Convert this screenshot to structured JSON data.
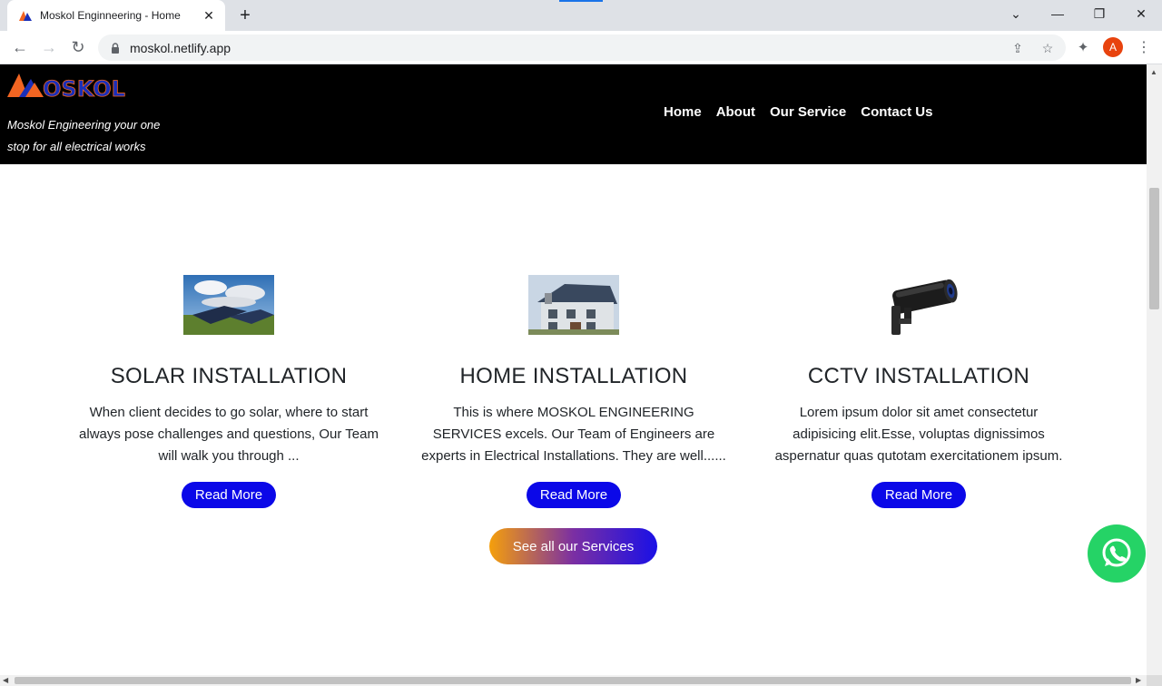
{
  "browser": {
    "tab_title": "Moskol Enginneering - Home",
    "url": "moskol.netlify.app",
    "profile_initial": "A"
  },
  "site": {
    "logo_text": "OSKOL",
    "tagline": "Moskol Engineering your one stop for all electrical works",
    "nav": [
      "Home",
      "About",
      "Our Service",
      "Contact Us"
    ]
  },
  "services": [
    {
      "title": "SOLAR INSTALLATION",
      "text": "When client decides to go solar, where to start always pose challenges and questions, Our Team will walk you through ...",
      "button": "Read More",
      "image": "solar-panels"
    },
    {
      "title": "HOME INSTALLATION",
      "text": "This is where MOSKOL ENGINEERING SERVICES excels. Our Team of Engineers are experts in Electrical Installations. They are well......",
      "button": "Read More",
      "image": "house"
    },
    {
      "title": "CCTV INSTALLATION",
      "text": "Lorem ipsum dolor sit amet consectetur adipisicing elit.Esse, voluptas dignissimos aspernatur quas qutotam exercitationem ipsum.",
      "button": "Read More",
      "image": "cctv-camera"
    }
  ],
  "see_all_button": "See all our Services",
  "colors": {
    "header_bg": "#000000",
    "read_more_bg": "#0b08e8",
    "whatsapp": "#25d366",
    "logo_orange": "#f26522",
    "logo_blue": "#1a2fb8"
  }
}
